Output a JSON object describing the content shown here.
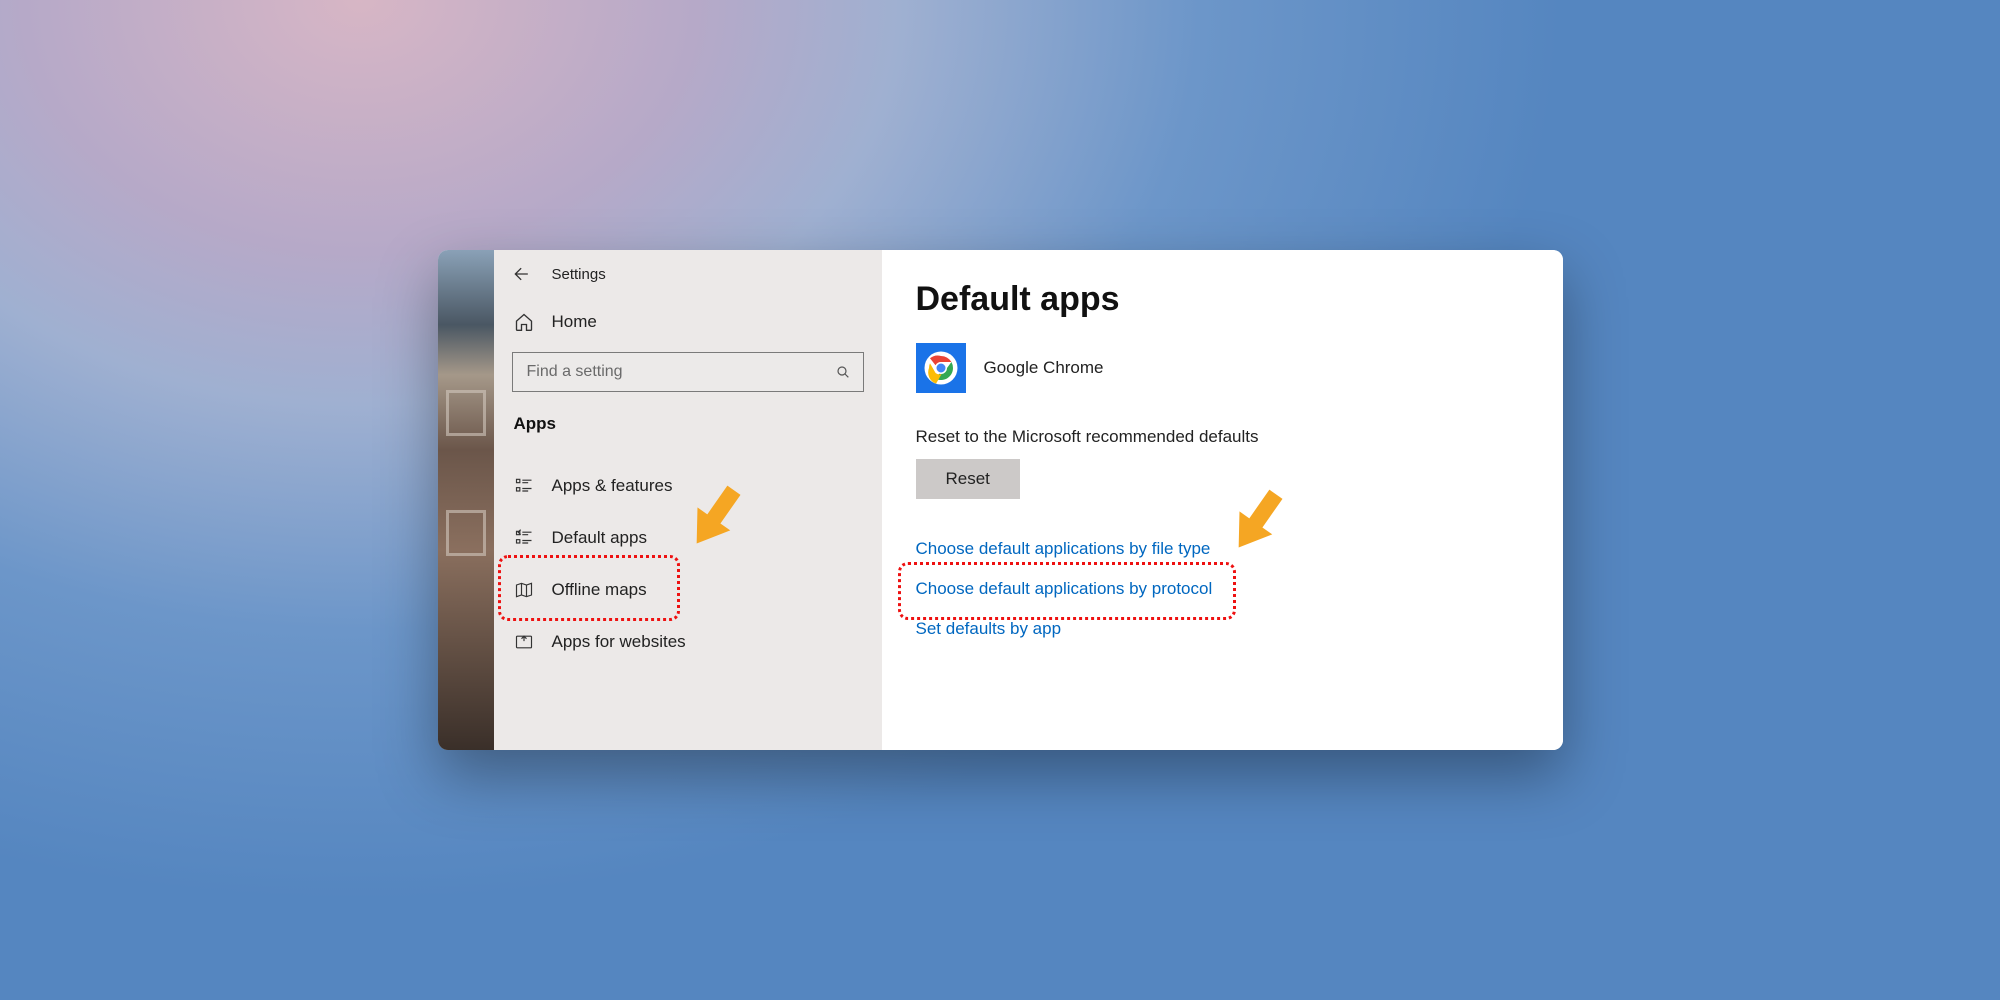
{
  "header": {
    "title": "Settings"
  },
  "sidebar": {
    "home": "Home",
    "search_placeholder": "Find a setting",
    "category": "Apps",
    "items": [
      {
        "label": "Apps & features"
      },
      {
        "label": "Default apps"
      },
      {
        "label": "Offline maps"
      },
      {
        "label": "Apps for websites"
      }
    ]
  },
  "main": {
    "title": "Default apps",
    "browser_name": "Google Chrome",
    "reset_label": "Reset to the Microsoft recommended defaults",
    "reset_button": "Reset",
    "links": [
      "Choose default applications by file type",
      "Choose default applications by protocol",
      "Set defaults by app"
    ]
  }
}
